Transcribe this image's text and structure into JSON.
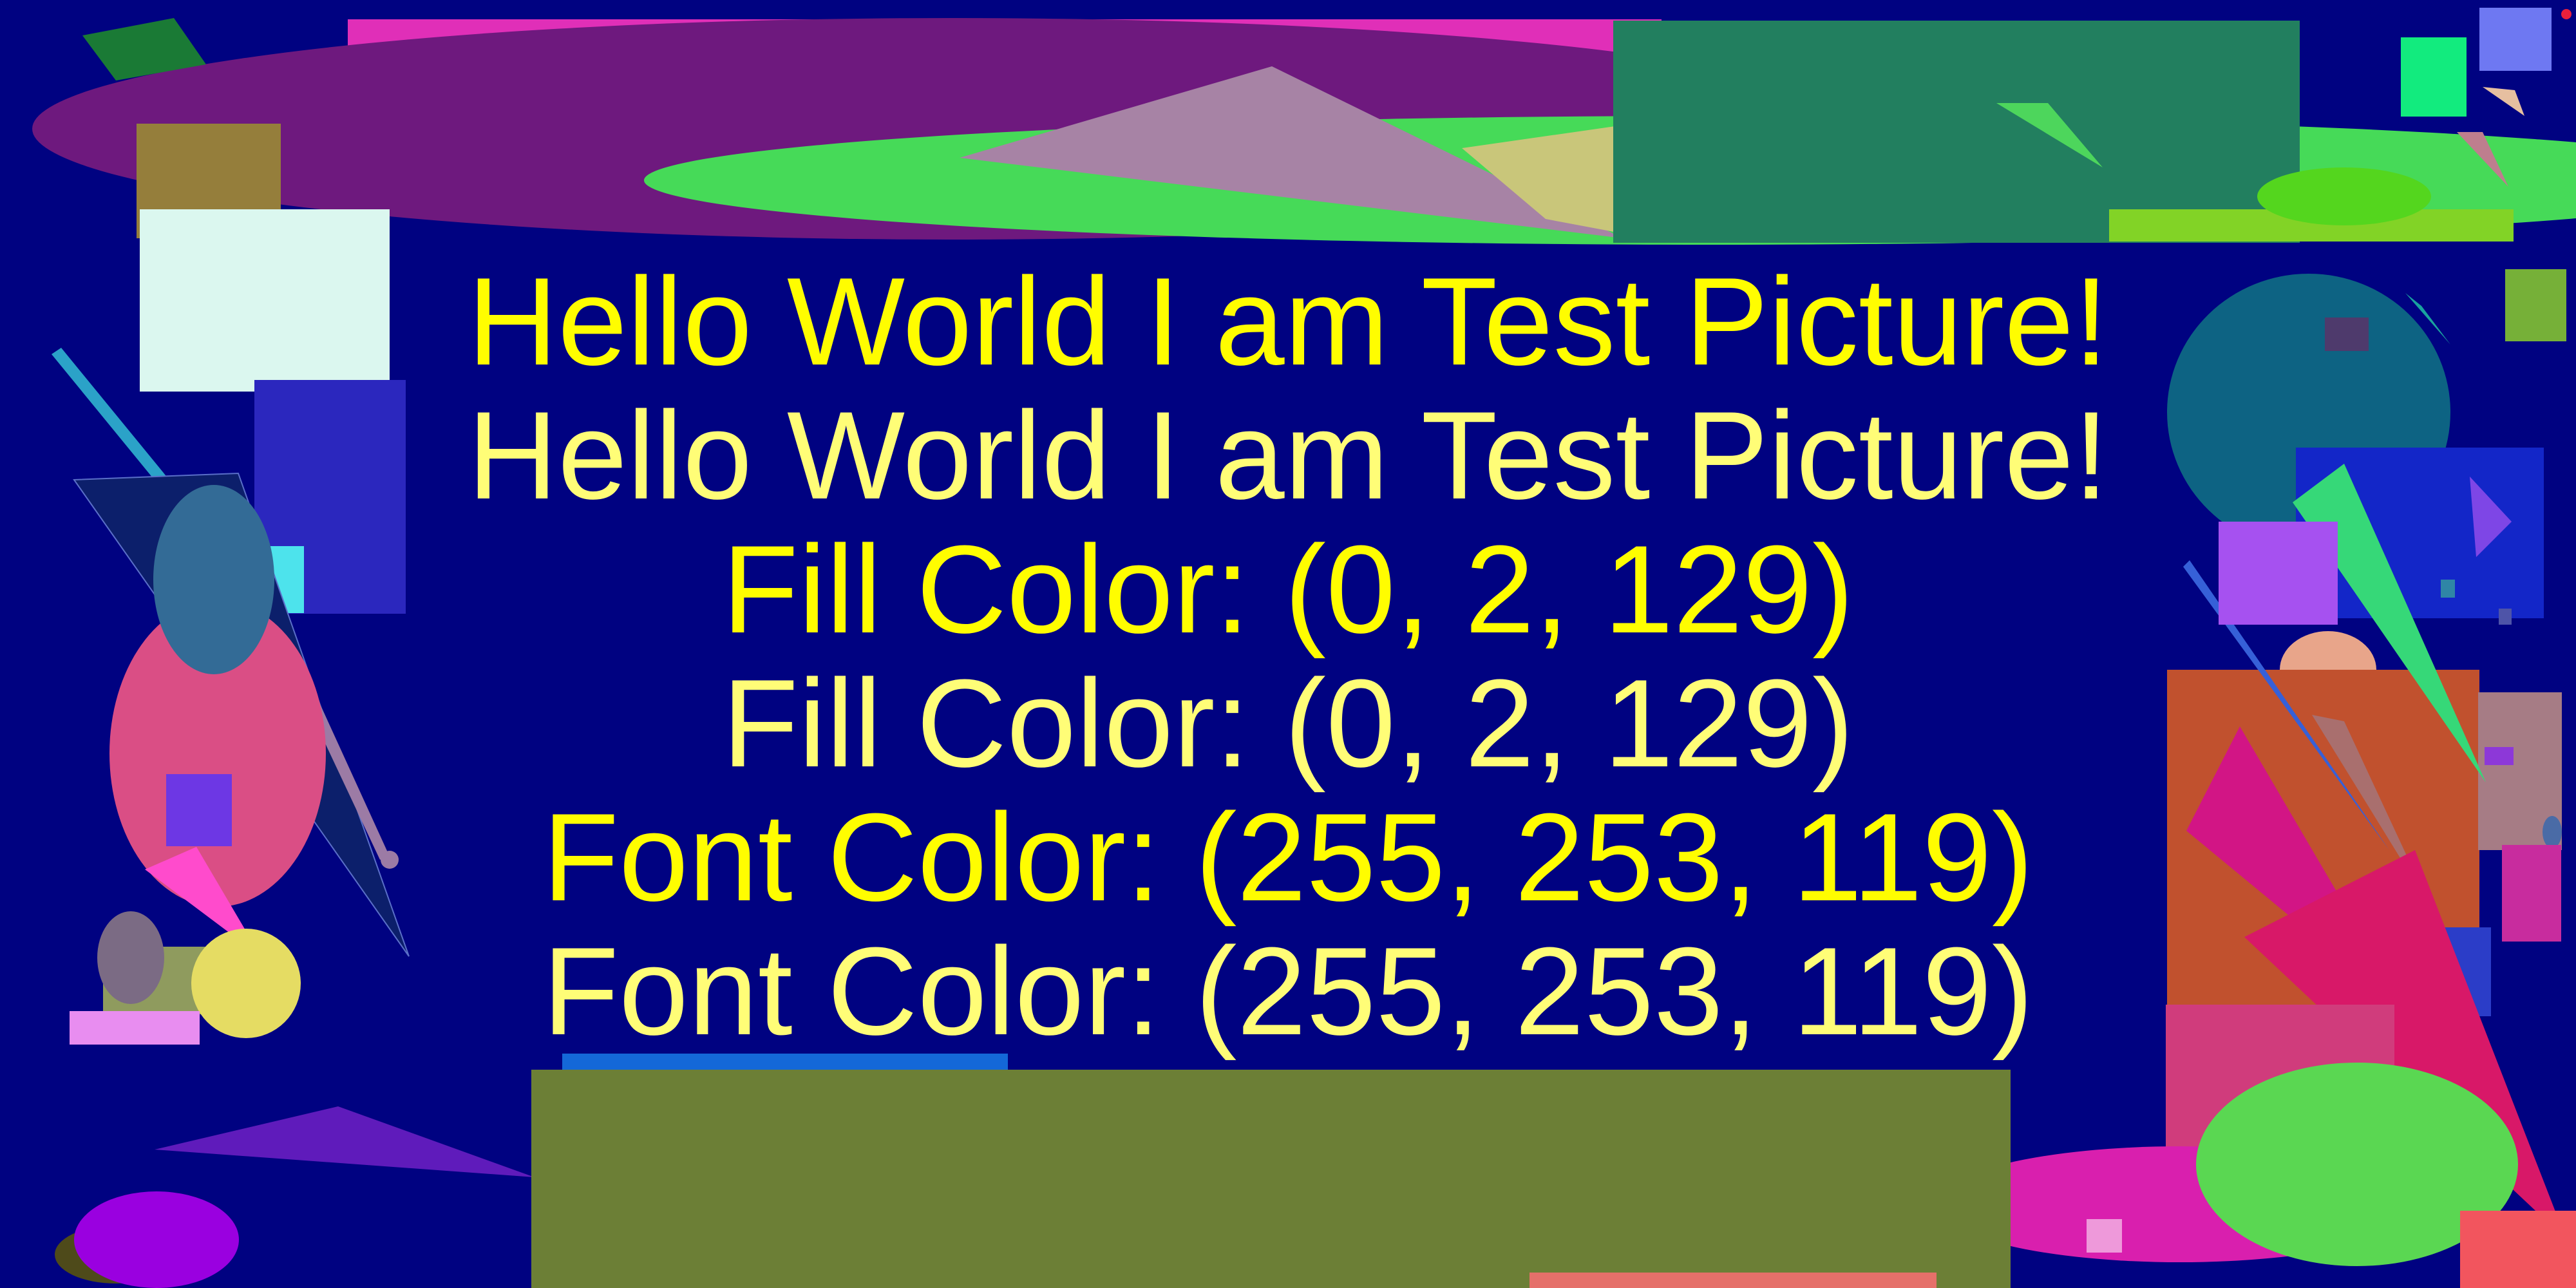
{
  "background_color": "#000281",
  "text_lines": [
    {
      "text": "Hello World I am Test Picture!",
      "color": "#FFFD00"
    },
    {
      "text": "Hello World I am Test Picture!",
      "color": "#FFFD77"
    },
    {
      "text": "Fill Color: (0, 2, 129)",
      "color": "#FFFD00"
    },
    {
      "text": "Fill Color: (0, 2, 129)",
      "color": "#FFFD77"
    },
    {
      "text": "Font Color: (255, 253, 119)",
      "color": "#FFFD00"
    },
    {
      "text": "Font Color: (255, 253, 119)",
      "color": "#FFFD77"
    }
  ]
}
